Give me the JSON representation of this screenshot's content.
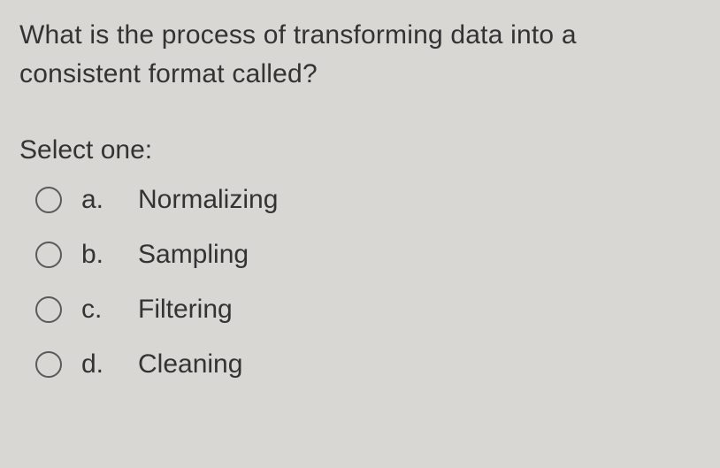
{
  "question": "What is the process of transforming data into a consistent format called?",
  "prompt": "Select one:",
  "options": [
    {
      "letter": "a.",
      "text": "Normalizing"
    },
    {
      "letter": "b.",
      "text": "Sampling"
    },
    {
      "letter": "c.",
      "text": "Filtering"
    },
    {
      "letter": "d.",
      "text": "Cleaning"
    }
  ]
}
